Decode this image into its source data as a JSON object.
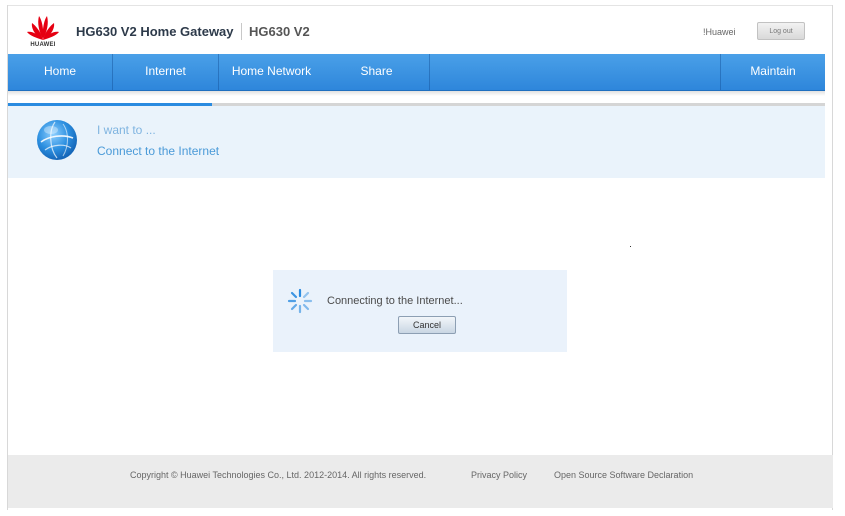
{
  "header": {
    "brand_logo_text": "HUAWEI",
    "product_title": "HG630 V2 Home Gateway",
    "product_model": "HG630 V2",
    "user_name": "!Huawei",
    "logout_label": "Log out"
  },
  "nav": {
    "items": [
      {
        "label": "Home"
      },
      {
        "label": "Internet"
      },
      {
        "label": "Home Network"
      },
      {
        "label": "Share"
      },
      {
        "label": "Maintain"
      }
    ]
  },
  "wizard": {
    "progress_fraction": 0.25,
    "intro_label": "I want to ...",
    "task_label": "Connect to the Internet"
  },
  "dialog": {
    "message": "Connecting to the Internet...",
    "cancel_label": "Cancel"
  },
  "footer": {
    "copyright": "Copyright © Huawei Technologies Co., Ltd. 2012-2014. All rights reserved.",
    "privacy_label": "Privacy Policy",
    "open_source_label": "Open Source Software Declaration"
  },
  "colors": {
    "nav_blue": "#2e86db",
    "brand_red": "#e60012",
    "panel_light_blue": "#eaf3fb",
    "footer_gray": "#ebebeb"
  },
  "icons": {
    "brand": "huawei-petal-logo",
    "wizard": "globe-icon",
    "loading": "spinner-icon"
  }
}
